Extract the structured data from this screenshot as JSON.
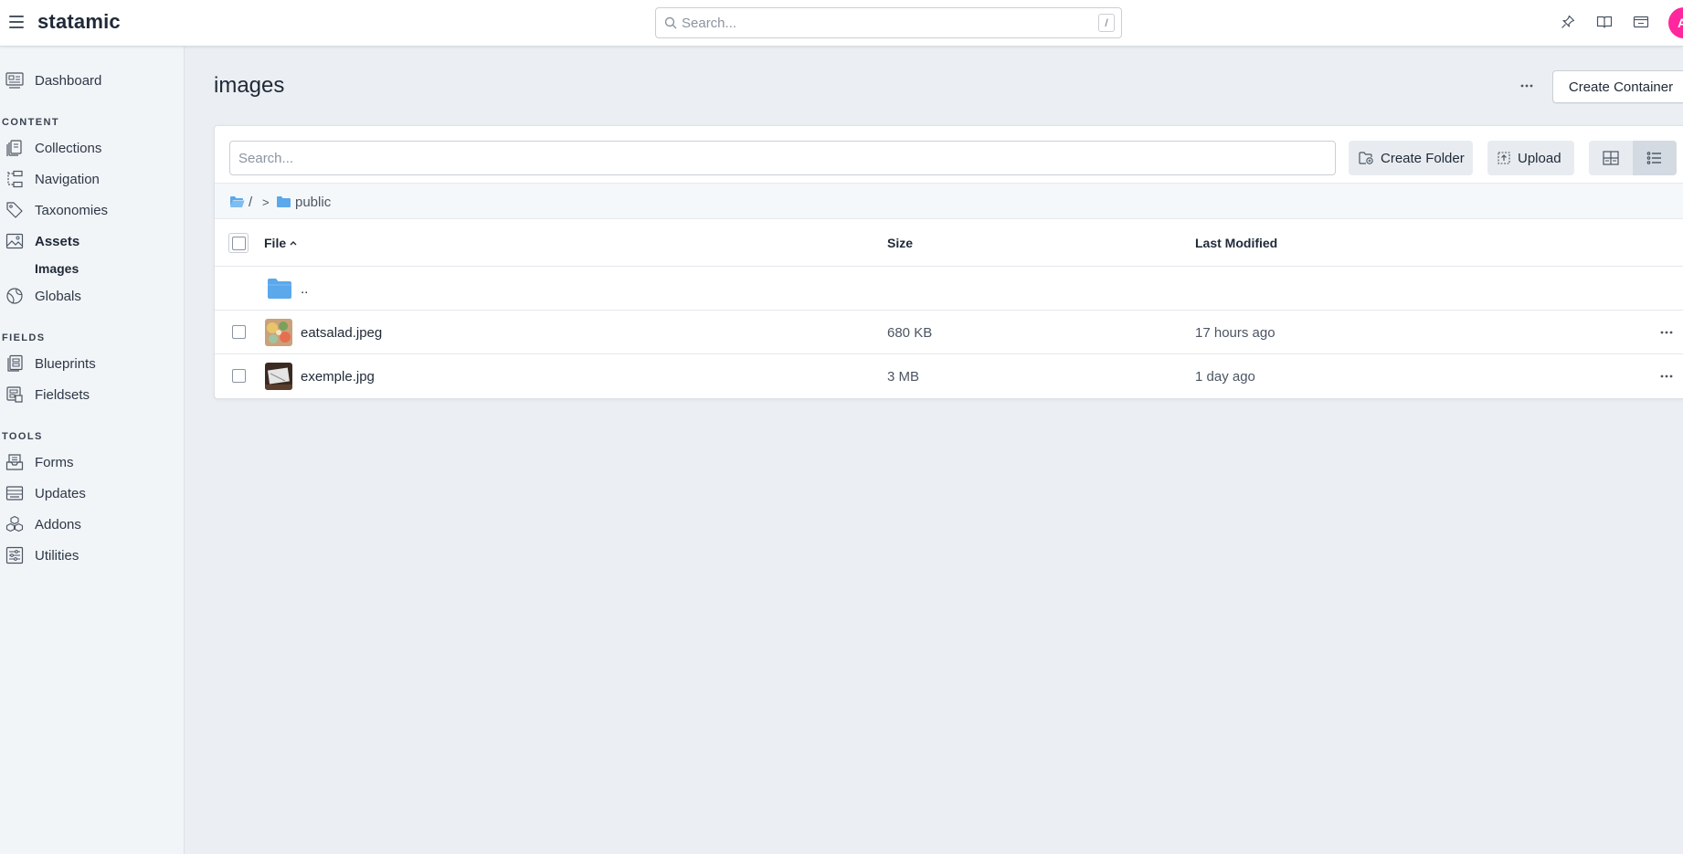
{
  "app": {
    "logo": "statamic",
    "avatar_initial": "A",
    "accent_color": "#ff269e"
  },
  "topbar": {
    "search_placeholder": "Search...",
    "search_shortcut": "/",
    "icons": [
      "pin-icon",
      "docs-book-icon",
      "site-preview-icon"
    ]
  },
  "sidebar": {
    "dashboard": "Dashboard",
    "sections": {
      "content": "CONTENT",
      "fields": "FIELDS",
      "tools": "TOOLS"
    },
    "content_items": [
      "Collections",
      "Navigation",
      "Taxonomies",
      "Assets"
    ],
    "assets_sub": "Images",
    "globals": "Globals",
    "fields_items": [
      "Blueprints",
      "Fieldsets"
    ],
    "tools_items": [
      "Forms",
      "Updates",
      "Addons",
      "Utilities"
    ]
  },
  "page": {
    "title": "images",
    "create_container_label": "Create Container"
  },
  "browser": {
    "search_placeholder": "Search...",
    "create_folder_label": "Create Folder",
    "upload_label": "Upload",
    "breadcrumb": {
      "root": "/",
      "separator": ">",
      "folder": "public"
    },
    "columns": {
      "file": "File",
      "size": "Size",
      "modified": "Last Modified"
    },
    "parent_folder": "..",
    "rows": [
      {
        "name": "eatsalad.jpeg",
        "size": "680 KB",
        "modified": "17 hours ago"
      },
      {
        "name": "exemple.jpg",
        "size": "3 MB",
        "modified": "1 day ago"
      }
    ]
  }
}
